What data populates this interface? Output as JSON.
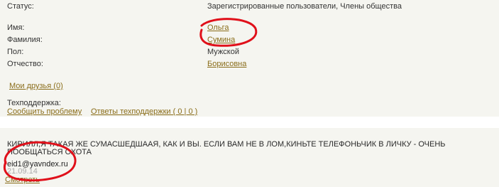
{
  "profile": {
    "status_label": "Статус:",
    "status_value": "Зарегистрированные пользователи, Члены общества",
    "first_name_label": "Имя:",
    "first_name_value": "Ольга",
    "last_name_label": "Фамилия:",
    "last_name_value": "Сумина",
    "gender_label": "Пол:",
    "gender_value": "Мужской",
    "patronymic_label": "Отчество:",
    "patronymic_value": "Борисовна",
    "friends_link": "Мои друзья (0)",
    "support_label": "Техподдержка:",
    "report_problem_link": "Сообщить проблему",
    "support_answers_link": "Ответы техподдержки ( 0 | 0 )"
  },
  "comment": {
    "text": "КИРИЛЛ,Я ТАКАЯ ЖЕ СУМАСШЕДШААЯ, КАК И ВЫ. ЕСЛИ ВАМ НЕ В ЛОМ,КИНЬТЕ ТЕЛЕФОНЬЧИК В ЛИЧКУ - ОЧЕНЬ ПООБЩАТЬСЯ ОХОТА",
    "email": "eid1@yavndex.ru",
    "date": "21.09.14",
    "view_link": "Смотреть"
  },
  "colors": {
    "link": "#8a6d1a",
    "annotation": "#e0101a"
  }
}
